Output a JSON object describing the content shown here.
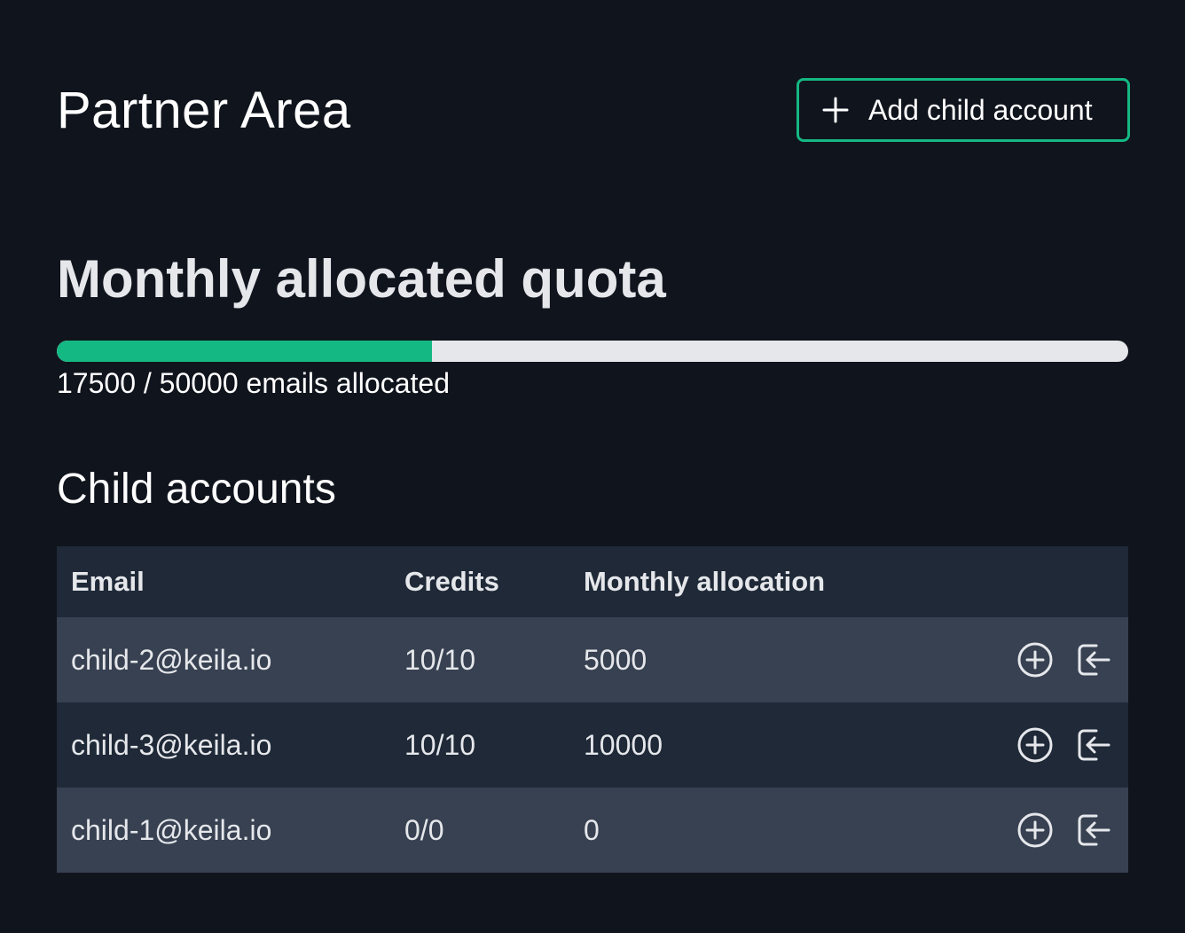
{
  "header": {
    "title": "Partner Area",
    "add_button_label": "Add child account",
    "add_button_icon": "plus-icon"
  },
  "quota": {
    "title": "Monthly allocated quota",
    "allocated": 17500,
    "total": 50000,
    "fill_fraction": 0.35,
    "text": "17500 / 50000 emails allocated",
    "fill_color": "#14b883",
    "track_color": "#e5e7eb"
  },
  "child_accounts": {
    "title": "Child accounts",
    "columns": [
      "Email",
      "Credits",
      "Monthly allocation"
    ],
    "rows": [
      {
        "email": "child-2@keila.io",
        "credits": "10/10",
        "allocation": "5000"
      },
      {
        "email": "child-3@keila.io",
        "credits": "10/10",
        "allocation": "10000"
      },
      {
        "email": "child-1@keila.io",
        "credits": "0/0",
        "allocation": "0"
      }
    ],
    "row_actions": [
      "add-credits-icon",
      "login-as-icon"
    ]
  },
  "colors": {
    "background": "#10141d",
    "accent": "#14b883",
    "header_row": "#1f2937",
    "row_light": "#374151",
    "row_dark": "#1f2937"
  }
}
